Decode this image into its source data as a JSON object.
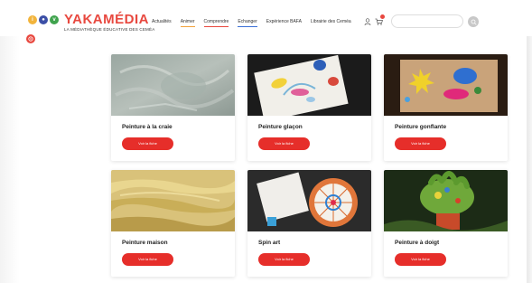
{
  "brand": {
    "name": "YAKAMÉDIA",
    "tagline": "LA MÉDIATHÈQUE ÉDUCATIVE DES CEMÉA",
    "colors": {
      "accent": "#e62e2a",
      "orange": "#f2a13b",
      "blue": "#3b6fd6",
      "green": "#3fa34d"
    }
  },
  "nav": {
    "items": [
      {
        "label": "Actualités"
      },
      {
        "label": "Animer"
      },
      {
        "label": "Comprendre"
      },
      {
        "label": "Echanger"
      },
      {
        "label": "Expérience BAFA"
      },
      {
        "label": "Librairie des Ceméa"
      }
    ]
  },
  "header_icons": [
    "user-icon",
    "cart-icon",
    "search-icon"
  ],
  "search": {
    "placeholder": ""
  },
  "cards": [
    {
      "title": "Peinture à la craie",
      "button": "Voir la fiche"
    },
    {
      "title": "Peinture glaçon",
      "button": "Voir la fiche"
    },
    {
      "title": "Peinture gonflante",
      "button": "Voir la fiche"
    },
    {
      "title": "Peinture maison",
      "button": "Voir la fiche"
    },
    {
      "title": "Spin art",
      "button": "Voir la fiche"
    },
    {
      "title": "Peinture à doigt",
      "button": "Voir la fiche"
    }
  ]
}
